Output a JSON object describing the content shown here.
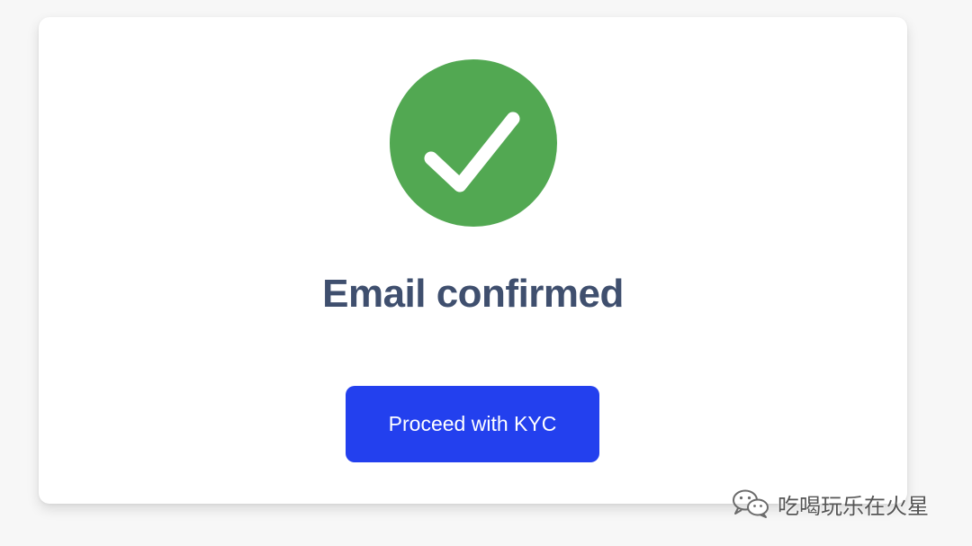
{
  "card": {
    "title": "Email confirmed",
    "icon": "check-circle-icon",
    "button_label": "Proceed with KYC"
  },
  "watermark": {
    "icon": "wechat-icon",
    "text": "吃喝玩乐在火星"
  },
  "colors": {
    "success": "#52a852",
    "accent": "#2340ee",
    "title": "#3f4f6e"
  }
}
